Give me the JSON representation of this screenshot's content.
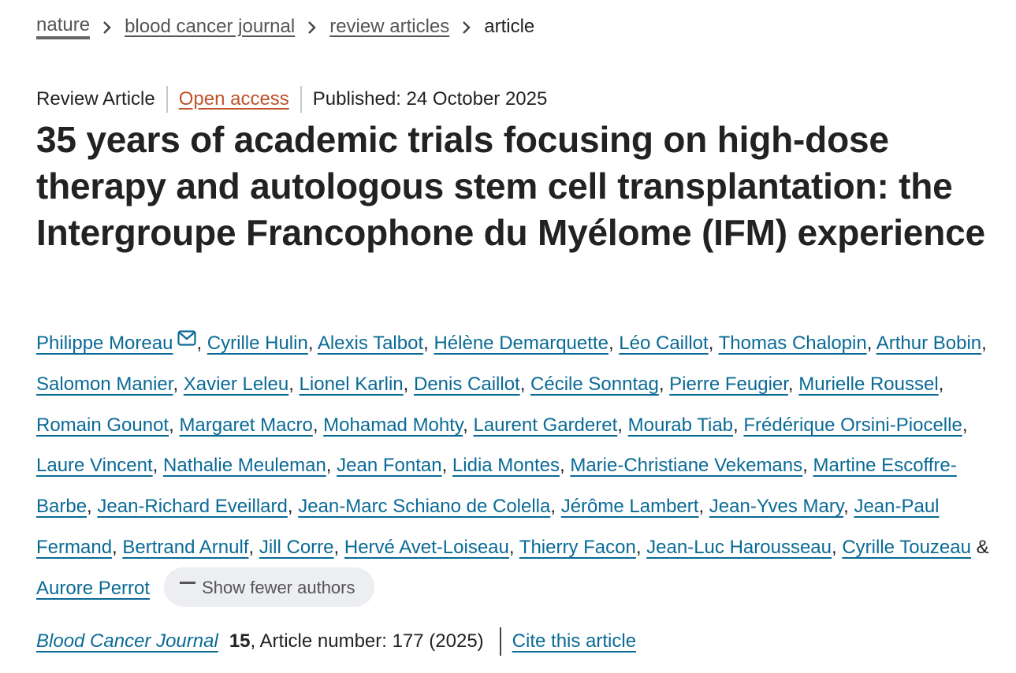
{
  "breadcrumb": {
    "items": [
      "nature",
      "blood cancer journal",
      "review articles"
    ],
    "current": "article"
  },
  "meta": {
    "type": "Review Article",
    "access": "Open access",
    "published": "Published: 24 October 2025"
  },
  "title": "35 years of academic trials focusing on high-dose therapy and autologous stem cell transplantation: the Intergroupe Francophone du Myélome (IFM) experience",
  "authors": [
    "Philippe Moreau",
    "Cyrille Hulin",
    "Alexis Talbot",
    "Hélène Demarquette",
    "Léo Caillot",
    "Thomas Chalopin",
    "Arthur Bobin",
    "Salomon Manier",
    "Xavier Leleu",
    "Lionel Karlin",
    "Denis Caillot",
    "Cécile Sonntag",
    "Pierre Feugier",
    "Murielle Roussel",
    "Romain Gounot",
    "Margaret Macro",
    "Mohamad Mohty",
    "Laurent Garderet",
    "Mourab Tiab",
    "Frédérique Orsini-Piocelle",
    "Laure Vincent",
    "Nathalie Meuleman",
    "Jean Fontan",
    "Lidia Montes",
    "Marie-Christiane Vekemans",
    "Martine Escoffre-Barbe",
    "Jean-Richard Eveillard",
    "Jean-Marc Schiano de Colella",
    "Jérôme Lambert",
    "Jean-Yves Mary",
    "Jean-Paul Fermand",
    "Bertrand Arnulf",
    "Jill Corre",
    "Hervé Avet-Loiseau",
    "Thierry Facon",
    "Jean-Luc Harousseau",
    "Cyrille Touzeau",
    "Aurore Perrot"
  ],
  "author_separator": ", ",
  "author_last_joiner": " & ",
  "show_fewer_label": "Show fewer authors",
  "citation": {
    "journal": "Blood Cancer Journal",
    "volume": "15",
    "details": ", Article number: 177 (2025)",
    "cite_label": "Cite this article"
  },
  "colors": {
    "link": "#0a6a96",
    "open_access": "#c0522b",
    "text": "#222222"
  },
  "icons": {
    "breadcrumb_separator": "chevron-right-icon",
    "corresponding_author": "envelope-icon",
    "collapse": "minus-icon"
  }
}
